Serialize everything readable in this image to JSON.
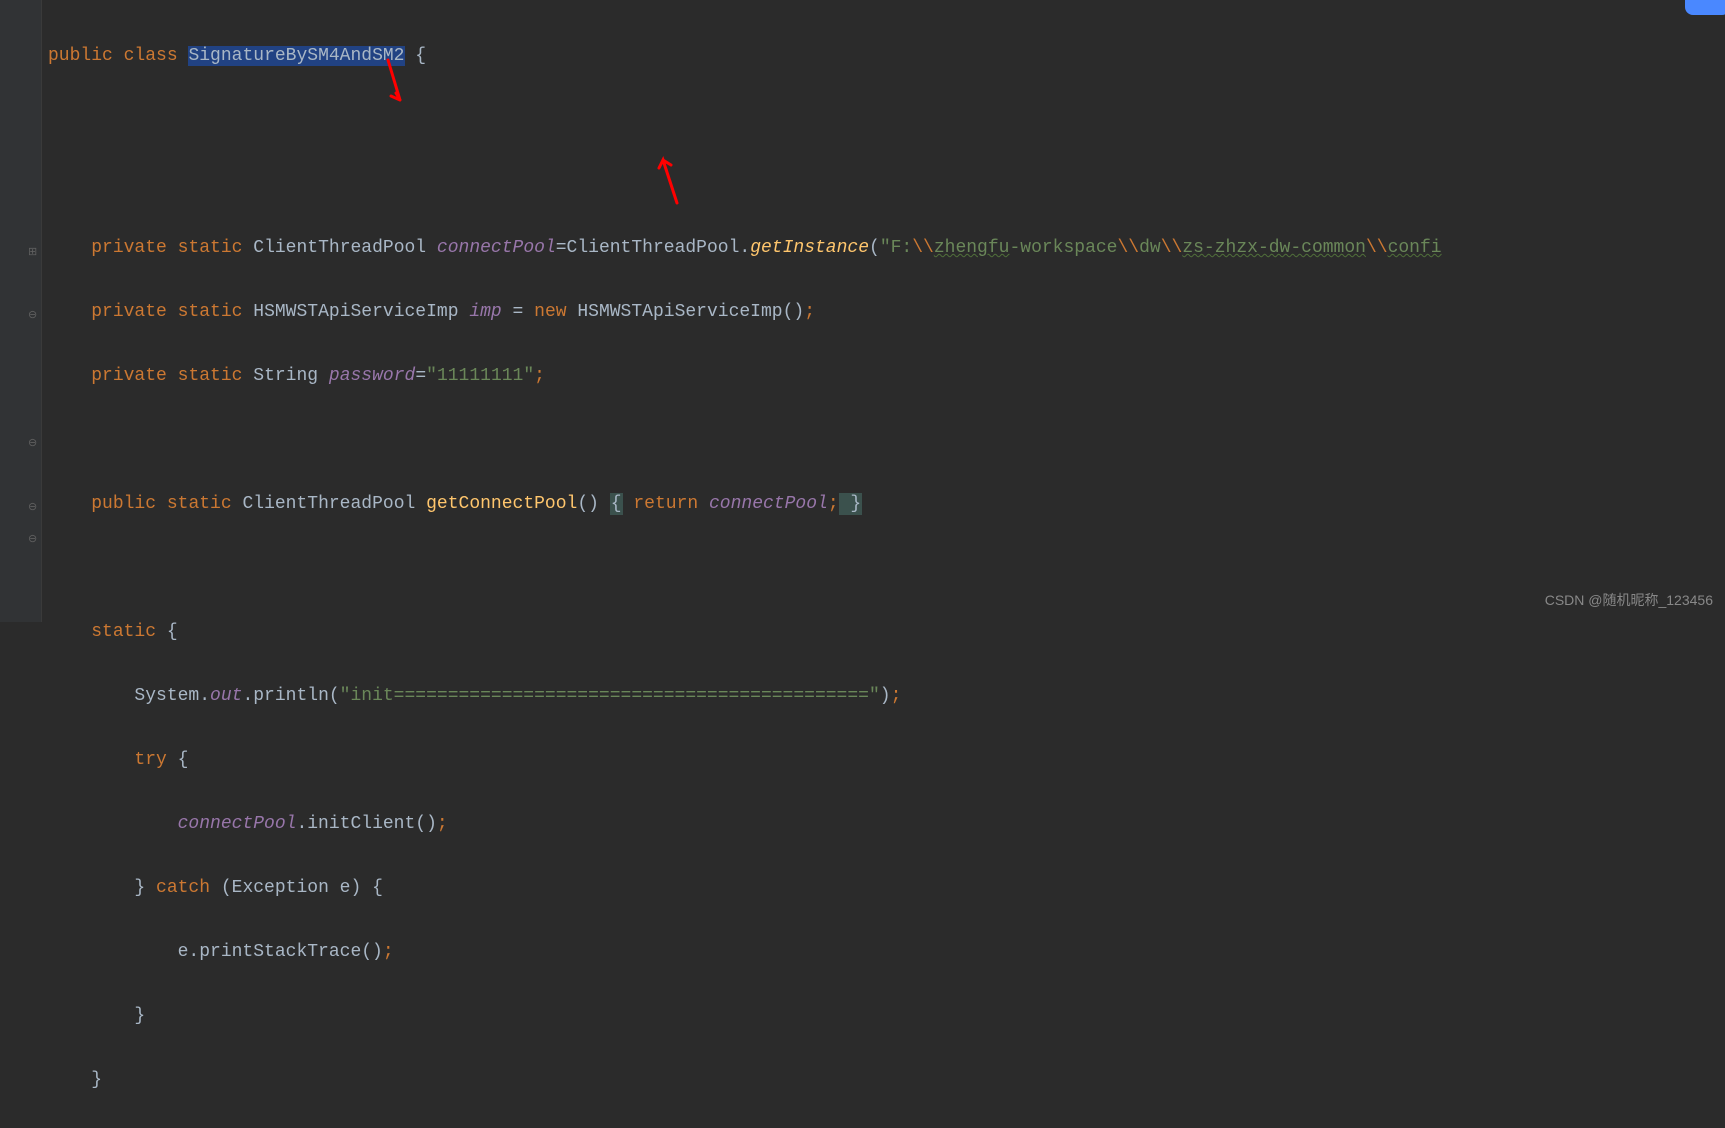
{
  "code": {
    "line1": {
      "public": "public",
      "class": "class",
      "className": "SignatureBySM4AndSM2",
      "brace": " {"
    },
    "line4": {
      "private": "private",
      "static": "static",
      "type": "ClientThreadPool",
      "field": "connectPool",
      "equals": "=ClientThreadPool.",
      "method": "getInstance",
      "paren": "(",
      "strStart": "\"F:",
      "esc1": "\\\\",
      "strPath1": "zhengfu",
      "strPath2": "-workspace",
      "esc2": "\\\\",
      "strPath3": "dw",
      "esc3": "\\\\",
      "strPath4": "zs-zhzx-dw-common",
      "esc4": "\\\\",
      "strPath5": "confi"
    },
    "line5": {
      "private": "private",
      "static": "static",
      "type": "HSMWSTApiServiceImp",
      "field": "imp",
      "equals": " = ",
      "new": "new",
      "ctor": " HSMWSTApiServiceImp()",
      "semi": ";"
    },
    "line6": {
      "private": "private",
      "static": "static",
      "type": "String",
      "field": "password",
      "equals": "=",
      "value": "\"11111111\"",
      "semi": ";"
    },
    "line8": {
      "public": "public",
      "static": "static",
      "type": "ClientThreadPool",
      "method": "getConnectPool",
      "parens": "() ",
      "brace1": "{",
      "return": " return ",
      "field": "connectPool",
      "semi": ";",
      "brace2": " }"
    },
    "line10": {
      "static": "static",
      "brace": " {"
    },
    "line11": {
      "obj": "System.",
      "out": "out",
      "dot": ".println(",
      "str": "\"init============================================\"",
      "end": ")",
      "semi": ";"
    },
    "line12": {
      "try": "try",
      "brace": " {"
    },
    "line13": {
      "field": "connectPool",
      "call": ".initClient()",
      "semi": ";"
    },
    "line14": {
      "brace": "} ",
      "catch": "catch",
      "params": " (Exception e) {"
    },
    "line15": {
      "call": "e.printStackTrace()",
      "semi": ";"
    },
    "line16": {
      "brace": "}"
    },
    "line17": {
      "brace": "}"
    }
  },
  "watermark": "CSDN @随机昵称_123456"
}
